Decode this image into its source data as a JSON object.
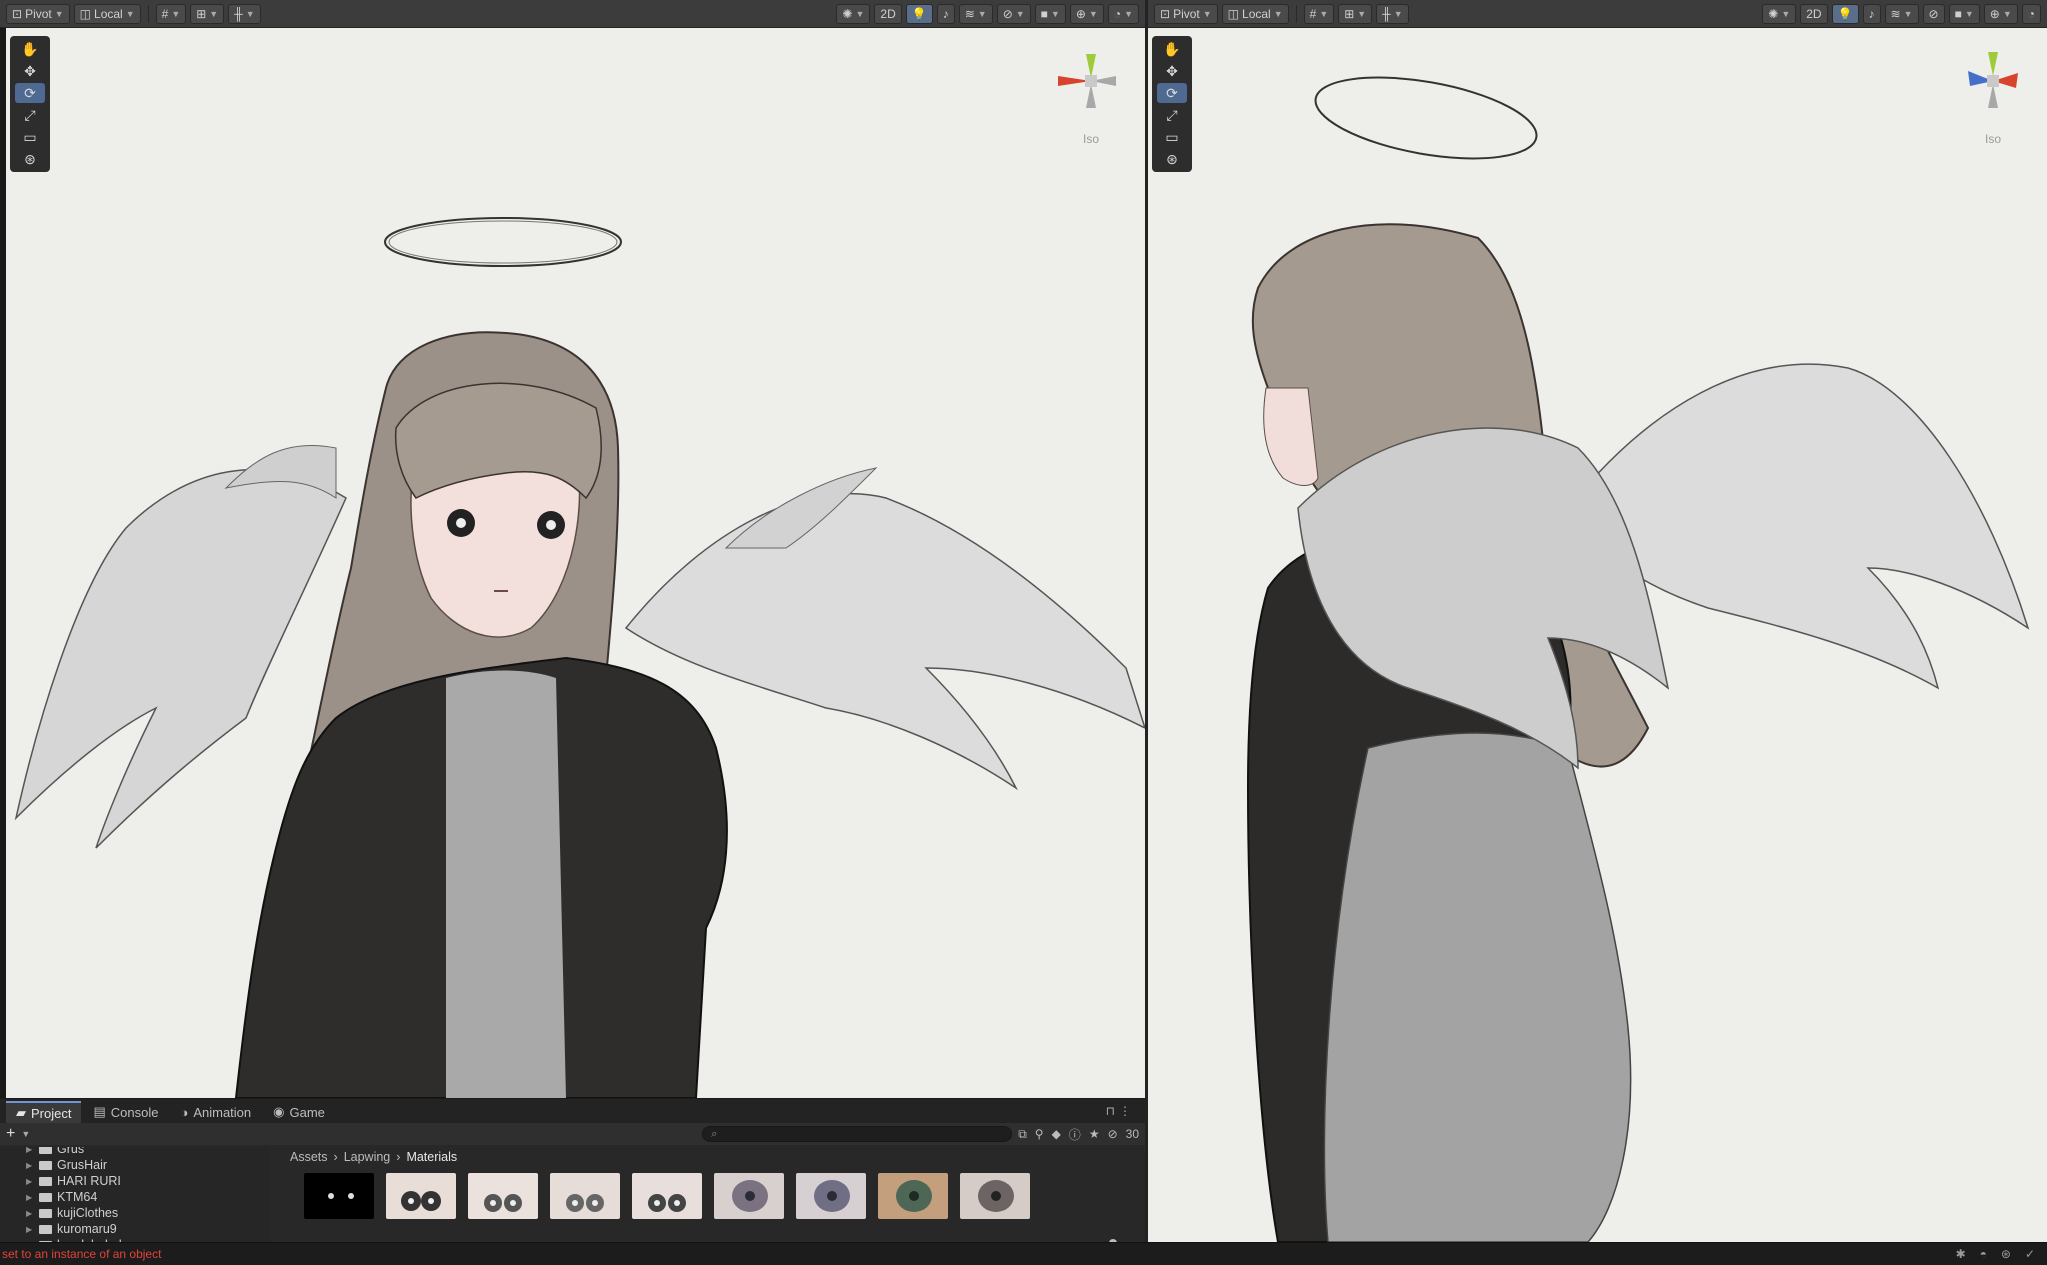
{
  "left_toolbar": {
    "pivot": "Pivot",
    "local": "Local",
    "btn_2d": "2D"
  },
  "right_toolbar": {
    "pivot": "Pivot",
    "local": "Local",
    "btn_2d": "2D"
  },
  "left_view": {
    "gizmo_label": "Iso"
  },
  "right_view": {
    "gizmo_label": "Iso"
  },
  "dock": {
    "tabs": [
      {
        "label": "Project",
        "icon": "folder-icon"
      },
      {
        "label": "Console",
        "icon": "console-icon"
      },
      {
        "label": "Animation",
        "icon": "animation-icon"
      },
      {
        "label": "Game",
        "icon": "gamepad-icon"
      }
    ],
    "add_label": "+",
    "hidden_count": "30",
    "tree": [
      "Grus",
      "GrusHair",
      "HARI RURI",
      "KTM64",
      "kujiClothes",
      "kuromaru9",
      "lan dabobuku"
    ],
    "breadcrumb": [
      "Assets",
      "Lapwing",
      "Materials"
    ]
  },
  "status": {
    "message": "set to an instance of an object"
  },
  "colors": {
    "accent": "#4e6a93",
    "error": "#e0443e",
    "viewport_bg": "#eeeeea"
  }
}
